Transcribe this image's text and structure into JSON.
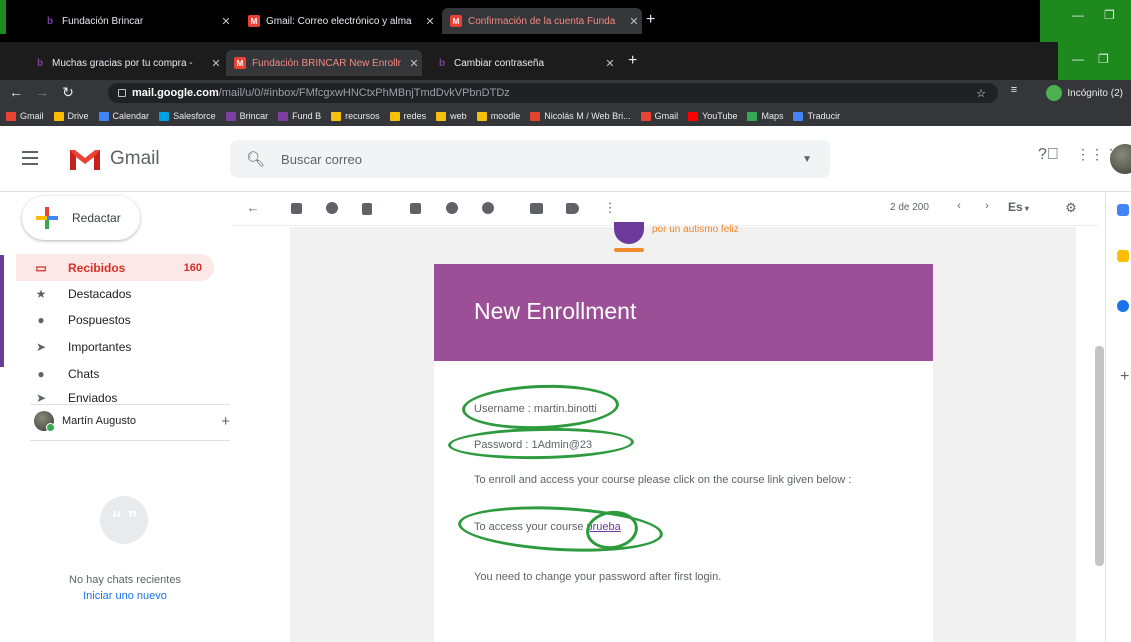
{
  "browser": {
    "tabs_row1": [
      {
        "title": "Fundación Brincar",
        "icon": "brincar-favicon"
      },
      {
        "title": "Gmail: Correo electrónico y alma",
        "icon": "gmail-favicon"
      },
      {
        "title": "Confirmación de la cuenta Funda",
        "icon": "gmail-favicon"
      }
    ],
    "tabs_row2": [
      {
        "title": "Muchas gracias por tu compra - ",
        "icon": "brincar-favicon"
      },
      {
        "title": "Fundación BRINCAR New Enrollr",
        "icon": "gmail-favicon"
      },
      {
        "title": "Cambiar contraseña",
        "icon": "brincar-favicon"
      }
    ],
    "url_host": "mail.google.com",
    "url_path": "/mail/u/0/#inbox/FMfcgxwHNCtxPhMBnjTmdDvkVPbnDTDz",
    "incognito_label": "Incógnito (2)",
    "bookmarks": [
      {
        "label": "Gmail",
        "color": "#ea4335"
      },
      {
        "label": "Drive",
        "color": "#fbbc04"
      },
      {
        "label": "Calendar",
        "color": "#4285f4"
      },
      {
        "label": "Salesforce",
        "color": "#00a1e0"
      },
      {
        "label": "Brincar",
        "color": "#7b3fa0"
      },
      {
        "label": "Fund B",
        "color": "#7b3fa0"
      },
      {
        "label": "recursos",
        "color": "#f4c20d"
      },
      {
        "label": "redes",
        "color": "#f4c20d"
      },
      {
        "label": "web",
        "color": "#f4c20d"
      },
      {
        "label": "moodle",
        "color": "#f4c20d"
      },
      {
        "label": "Nicolás M / Web Bri...",
        "color": "#e2432a"
      },
      {
        "label": "Gmail",
        "color": "#ea4335"
      },
      {
        "label": "YouTube",
        "color": "#ff0000"
      },
      {
        "label": "Maps",
        "color": "#34a853"
      },
      {
        "label": "Traducir",
        "color": "#4285f4"
      }
    ]
  },
  "gmail": {
    "logo_text": "Gmail",
    "search_placeholder": "Buscar correo",
    "compose_label": "Redactar",
    "nav": [
      {
        "label": "Recibidos",
        "count": "160",
        "icon": "inbox-icon",
        "glyph": "▭"
      },
      {
        "label": "Destacados",
        "count": "",
        "icon": "star-icon",
        "glyph": "★"
      },
      {
        "label": "Pospuestos",
        "count": "",
        "icon": "clock-icon",
        "glyph": "●"
      },
      {
        "label": "Importantes",
        "count": "",
        "icon": "important-icon",
        "glyph": "➤"
      },
      {
        "label": "Chats",
        "count": "",
        "icon": "chat-icon",
        "glyph": "●"
      },
      {
        "label": "Enviados",
        "count": "",
        "icon": "sent-icon",
        "glyph": "➤"
      }
    ],
    "hangouts_user": "Martín Augusto",
    "no_chats": "No hay chats recientes",
    "start_new": "Iniciar uno nuevo",
    "pager": "2 de 200",
    "lang": "Es"
  },
  "email": {
    "tagline": "por un autismo feliz",
    "title": "New Enrollment",
    "username_line": "Username : martin.binotti",
    "password_line": "Password : 1Admin@23",
    "instructions": "To enroll and access your course please click on the course link given below :",
    "access_prefix": "To access your course ",
    "course_link": "prueba",
    "change_password": "You need to change your password after first login."
  },
  "colors": {
    "header_purple": "#9b4f96",
    "annotation_green": "#2e9a3e",
    "gmail_red": "#d93025"
  }
}
